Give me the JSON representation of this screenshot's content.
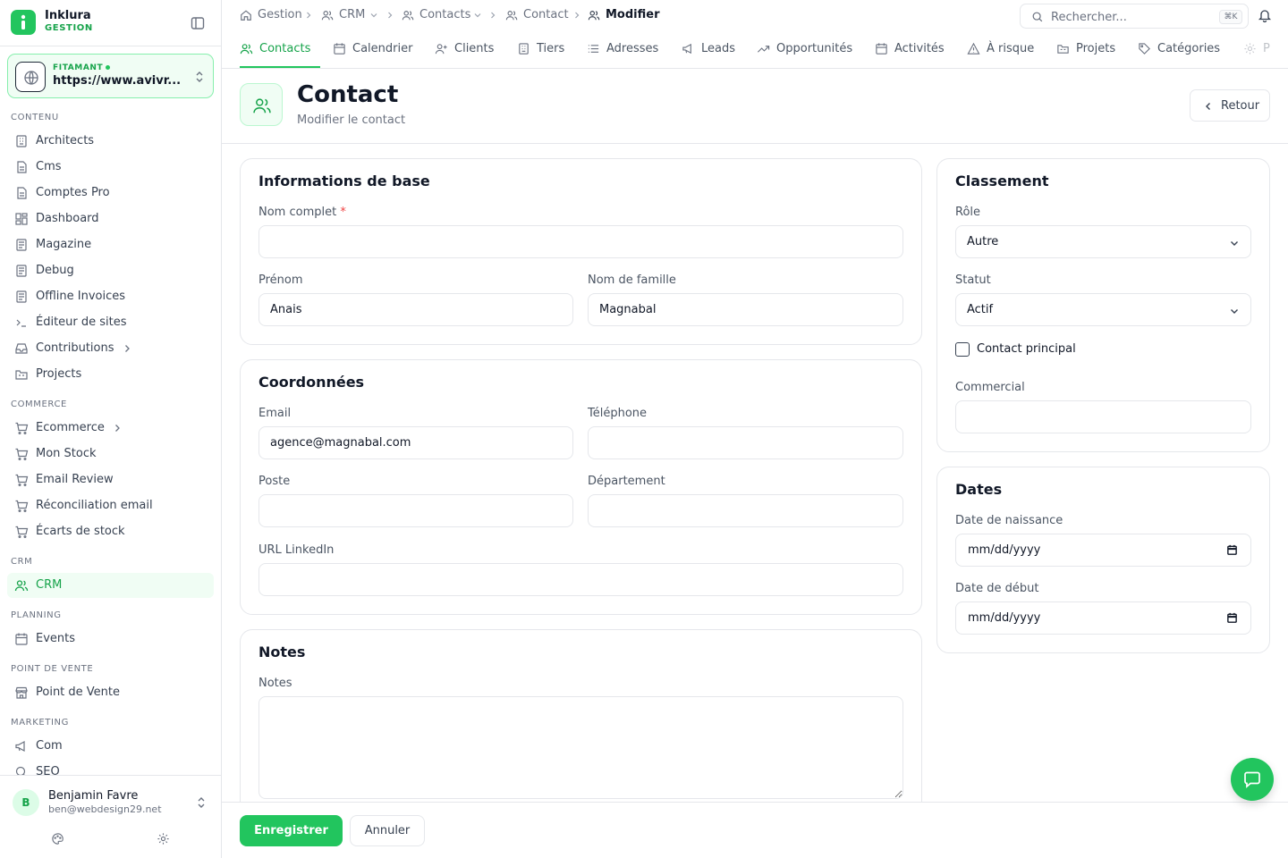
{
  "brand": {
    "name": "Inklura",
    "sub": "GESTION"
  },
  "site": {
    "label": "FITAMANT",
    "url": "https://www.avivr..."
  },
  "sections": {
    "contenu": "CONTENU",
    "commerce": "COMMERCE",
    "crm": "CRM",
    "planning": "PLANNING",
    "pos": "POINT DE VENTE",
    "marketing": "MARKETING"
  },
  "nav": {
    "architects": "Architects",
    "cms": "Cms",
    "comptes_pro": "Comptes Pro",
    "dashboard": "Dashboard",
    "magazine": "Magazine",
    "debug": "Debug",
    "offline_invoices": "Offline Invoices",
    "editeur": "Éditeur de sites",
    "contributions": "Contributions",
    "projects": "Projects",
    "ecommerce": "Ecommerce",
    "mon_stock": "Mon Stock",
    "email_review": "Email Review",
    "reconciliation": "Réconciliation email",
    "ecarts": "Écarts de stock",
    "crm": "CRM",
    "events": "Events",
    "pos": "Point de Vente",
    "com": "Com",
    "seo": "SEO"
  },
  "user": {
    "initial": "B",
    "name": "Benjamin Favre",
    "email": "ben@webdesign29.net"
  },
  "breadcrumb": {
    "gestion": "Gestion",
    "crm": "CRM",
    "contacts": "Contacts",
    "contact": "Contact",
    "current": "Modifier"
  },
  "search": {
    "placeholder": "Rechercher...",
    "shortcut": "⌘K"
  },
  "tabs": {
    "contacts": "Contacts",
    "calendrier": "Calendrier",
    "clients": "Clients",
    "tiers": "Tiers",
    "adresses": "Adresses",
    "leads": "Leads",
    "opportunites": "Opportunités",
    "activites": "Activités",
    "a_risque": "À risque",
    "projets": "Projets",
    "categories": "Catégories",
    "more": "P"
  },
  "page": {
    "title": "Contact",
    "subtitle": "Modifier le contact",
    "back": "Retour"
  },
  "basic": {
    "title": "Informations de base",
    "full_name_label": "Nom complet",
    "required_mark": "*",
    "full_name": "",
    "first_name_label": "Prénom",
    "first_name": "Anais",
    "last_name_label": "Nom de famille",
    "last_name": "Magnabal"
  },
  "coords": {
    "title": "Coordonnées",
    "email_label": "Email",
    "email": "agence@magnabal.com",
    "phone_label": "Téléphone",
    "phone": "",
    "poste_label": "Poste",
    "poste": "",
    "departement_label": "Département",
    "departement": "",
    "linkedin_label": "URL LinkedIn",
    "linkedin": ""
  },
  "notes": {
    "title": "Notes",
    "label": "Notes",
    "value": ""
  },
  "classement": {
    "title": "Classement",
    "role_label": "Rôle",
    "role": "Autre",
    "statut_label": "Statut",
    "statut": "Actif",
    "principal_label": "Contact principal",
    "principal_checked": false,
    "commercial_label": "Commercial",
    "commercial": ""
  },
  "dates": {
    "title": "Dates",
    "naissance_label": "Date de naissance",
    "naissance": "mm/dd/yyyy",
    "debut_label": "Date de début",
    "debut": "mm/dd/yyyy"
  },
  "actions": {
    "save": "Enregistrer",
    "cancel": "Annuler"
  },
  "colors": {
    "accent": "#22c55e",
    "accent_dark": "#16a34a",
    "accent_light": "#f0fdf4",
    "border": "#e5e7eb",
    "required": "#ef4444"
  }
}
